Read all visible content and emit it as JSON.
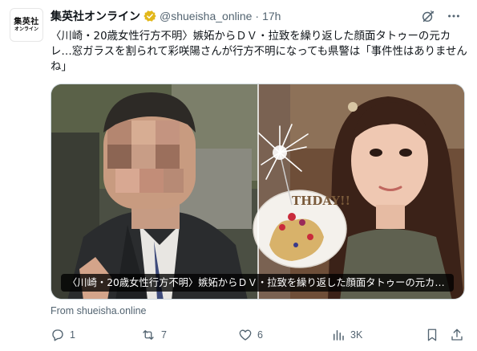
{
  "account": {
    "avatar_line1": "集英社",
    "avatar_line2": "オンライン",
    "name": "集英社オンライン",
    "handle": "@shueisha_online",
    "separator": "·",
    "time": "17h",
    "verified_color": "#e2b719"
  },
  "tweet": {
    "text": "〈川崎・20歳女性行方不明〉嫉妬からＤＶ・拉致を繰り返した顔面タトゥーの元カレ…窓ガラスを割られて彩咲陽さんが行方不明になっても県警は「事件性はありませんね」"
  },
  "media": {
    "caption": "〈川崎・20歳女性行方不明〉嫉妬からＤＶ・拉致を繰り返した顔面タトゥーの元カレ…",
    "cake_text": "THDAY!!"
  },
  "source": {
    "label": "From shueisha.online"
  },
  "actions": {
    "reply_count": "1",
    "repost_count": "7",
    "like_count": "6",
    "views_count": "3K"
  },
  "icons": [
    "grok-icon",
    "more-icon",
    "reply-icon",
    "repost-icon",
    "like-icon",
    "views-icon",
    "bookmark-icon",
    "share-icon"
  ],
  "colors": {
    "text_primary": "#0f1419",
    "text_secondary": "#536471",
    "border": "#cfd9de"
  }
}
